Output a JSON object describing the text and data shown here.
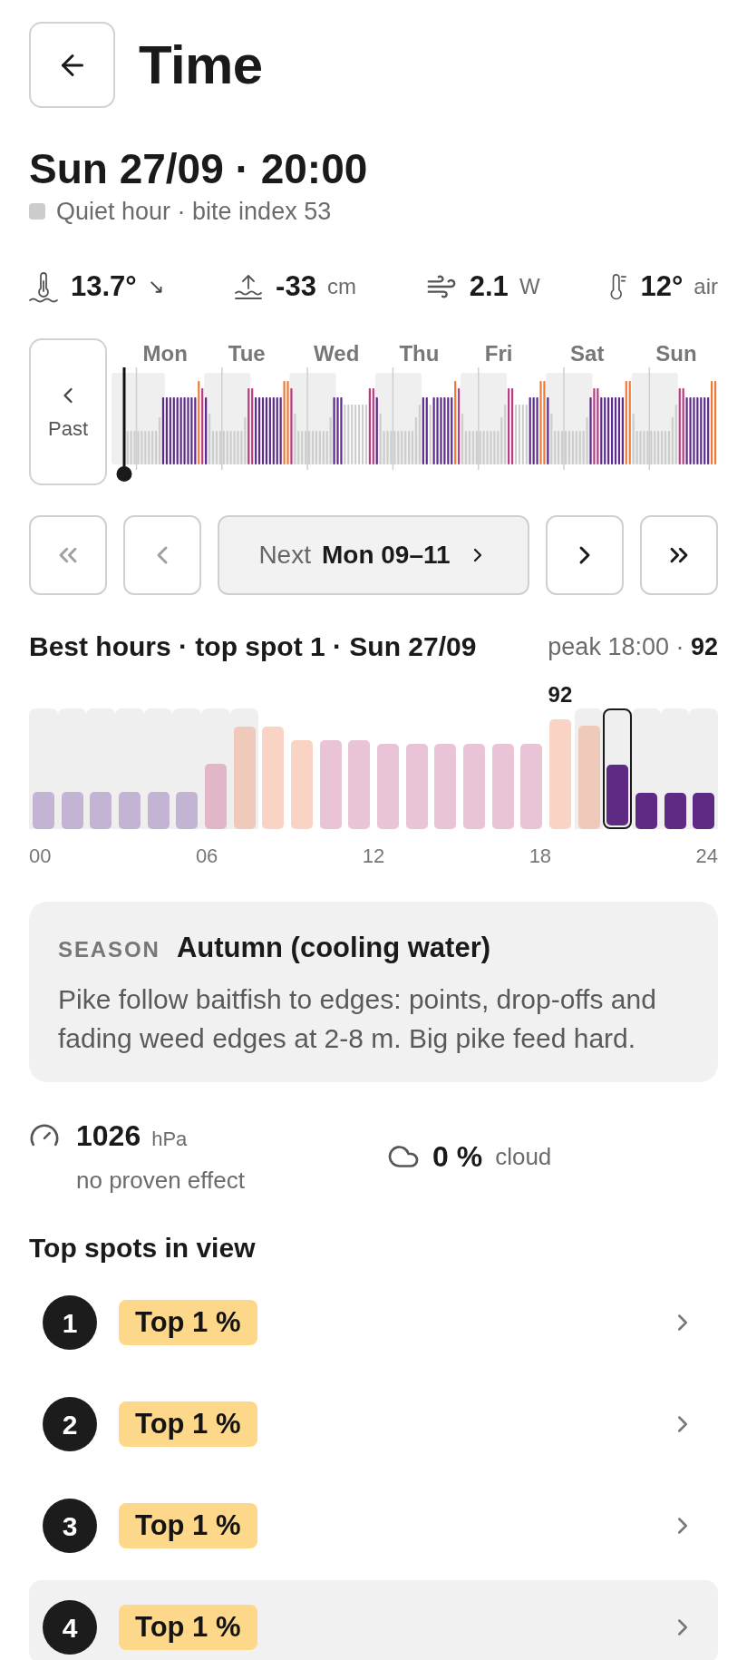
{
  "header": {
    "title": "Time"
  },
  "moment": {
    "title": "Sun 27/09 · 20:00",
    "status": {
      "text": "Quiet hour · bite index 53",
      "color": "#cccccc"
    }
  },
  "conditions": [
    {
      "kind": "water_temp",
      "value": "13.7°",
      "trend": "↘"
    },
    {
      "kind": "water_level",
      "value": "-33",
      "unit": "cm"
    },
    {
      "kind": "wind",
      "value": "2.1",
      "unit": "W"
    },
    {
      "kind": "air_temp",
      "value": "12°",
      "unit": "air"
    }
  ],
  "week_chart": {
    "past_button": "Past",
    "days": [
      "Mon",
      "Tue",
      "Wed",
      "Thu",
      "Fri",
      "Sat",
      "Sun"
    ]
  },
  "nav_buttons": [
    {
      "kind": "first",
      "disabled": true
    },
    {
      "kind": "prev",
      "disabled": true
    },
    {
      "kind": "next_window",
      "prefix": "Next",
      "label": "Mon 09–11",
      "disabled": false
    },
    {
      "kind": "next",
      "disabled": false
    },
    {
      "kind": "last",
      "disabled": false
    }
  ],
  "best_hours": {
    "title": "Best hours · top spot 1 · Sun 27/09",
    "peak": "peak 18:00 · **92**",
    "hours": [
      {
        "level": 0.31,
        "color": "#c4b4d4",
        "shaded": true,
        "selected": false
      },
      {
        "level": 0.31,
        "color": "#c4b4d4",
        "shaded": true,
        "selected": false
      },
      {
        "level": 0.31,
        "color": "#c4b4d4",
        "shaded": true,
        "selected": false
      },
      {
        "level": 0.31,
        "color": "#c4b4d4",
        "shaded": true,
        "selected": false
      },
      {
        "level": 0.31,
        "color": "#c4b4d4",
        "shaded": true,
        "selected": false
      },
      {
        "level": 0.31,
        "color": "#c4b4d4",
        "shaded": true,
        "selected": false
      },
      {
        "level": 0.54,
        "color": "#e1b6c9",
        "shaded": true,
        "selected": false
      },
      {
        "level": 0.85,
        "color": "#efc9b9",
        "shaded": true,
        "selected": false
      },
      {
        "level": 0.85,
        "color": "#f9d3c3",
        "shaded": false,
        "selected": false
      },
      {
        "level": 0.74,
        "color": "#f9d3c3",
        "shaded": false,
        "selected": false
      },
      {
        "level": 0.74,
        "color": "#e9c4d7",
        "shaded": false,
        "selected": false
      },
      {
        "level": 0.74,
        "color": "#e9c4d7",
        "shaded": false,
        "selected": false
      },
      {
        "level": 0.71,
        "color": "#e9c4d7",
        "shaded": false,
        "selected": false
      },
      {
        "level": 0.71,
        "color": "#e9c4d7",
        "shaded": false,
        "selected": false
      },
      {
        "level": 0.71,
        "color": "#e9c4d7",
        "shaded": false,
        "selected": false
      },
      {
        "level": 0.71,
        "color": "#e9c4d7",
        "shaded": false,
        "selected": false
      },
      {
        "level": 0.71,
        "color": "#e9c4d7",
        "shaded": false,
        "selected": false
      },
      {
        "level": 0.71,
        "color": "#e9c4d7",
        "shaded": false,
        "selected": false
      },
      {
        "level": 0.91,
        "color": "#f9d3c3",
        "shaded": false,
        "selected": false,
        "label": "92"
      },
      {
        "level": 0.86,
        "color": "#efc9b9",
        "shaded": true,
        "selected": false
      },
      {
        "level": 0.53,
        "color": "#5e2a84",
        "shaded": true,
        "selected": true
      },
      {
        "level": 0.3,
        "color": "#5e2a84",
        "shaded": true,
        "selected": false
      },
      {
        "level": 0.3,
        "color": "#5e2a84",
        "shaded": true,
        "selected": false
      },
      {
        "level": 0.3,
        "color": "#5e2a84",
        "shaded": true,
        "selected": false
      }
    ],
    "x_labels": [
      "00",
      "06",
      "12",
      "18",
      "24"
    ]
  },
  "season": {
    "label": "SEASON",
    "title": "Autumn (cooling water)",
    "text": "Pike follow baitfish to edges: points, drop-offs and fading weed edges at 2-8 m. Big pike feed hard."
  },
  "weather": {
    "pressure": {
      "value": "1026",
      "unit": "hPa",
      "note": "no proven effect"
    },
    "cloud": {
      "value": "0 %",
      "unit": "cloud"
    }
  },
  "top_spots": {
    "title": "Top spots in view",
    "items": [
      {
        "rank": "1",
        "badge": "Top 1 %",
        "selected": false
      },
      {
        "rank": "2",
        "badge": "Top 1 %",
        "selected": false
      },
      {
        "rank": "3",
        "badge": "Top 1 %",
        "selected": false
      },
      {
        "rank": "4",
        "badge": "Top 1 %",
        "selected": true
      }
    ]
  }
}
